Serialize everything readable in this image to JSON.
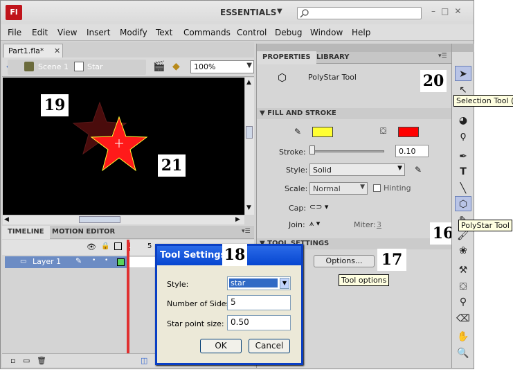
{
  "app": {
    "logo": "Fl",
    "workspace": "ESSENTIALS"
  },
  "menu": [
    "File",
    "Edit",
    "View",
    "Insert",
    "Modify",
    "Text",
    "Commands",
    "Control",
    "Debug",
    "Window",
    "Help"
  ],
  "document": {
    "tab": "Part1.fla*",
    "scene": "Scene 1",
    "symbol": "Star",
    "zoom": "100%"
  },
  "timeline": {
    "tabs": [
      "TIMELINE",
      "MOTION EDITOR"
    ],
    "layer": "Layer 1",
    "frame_marks": [
      "1",
      "5"
    ]
  },
  "properties": {
    "tabs": [
      "PROPERTIES",
      "LIBRARY"
    ],
    "tool_name": "PolyStar Tool",
    "fill_stroke_title": "FILL AND STROKE",
    "stroke_color": "#ffff33",
    "fill_color": "#ff0000",
    "stroke_label": "Stroke:",
    "stroke_value": "0.10",
    "style_label": "Style:",
    "style_value": "Solid",
    "scale_label": "Scale:",
    "scale_value": "Normal",
    "hinting_label": "Hinting",
    "cap_label": "Cap:",
    "join_label": "Join:",
    "miter_label": "Miter:",
    "miter_value": "3",
    "tool_settings_title": "TOOL SETTINGS",
    "options_button": "Options..."
  },
  "tooltips": {
    "selection": "Selection Tool (V)",
    "polystar": "PolyStar Tool",
    "options": "Tool options"
  },
  "callouts": [
    "16",
    "17",
    "18",
    "19",
    "20",
    "21"
  ],
  "dialog": {
    "title": "Tool Settings",
    "style_label": "Style:",
    "style_value": "star",
    "sides_label": "Number of Sides:",
    "sides_value": "5",
    "point_label": "Star point size:",
    "point_value": "0.50",
    "ok": "OK",
    "cancel": "Cancel"
  }
}
